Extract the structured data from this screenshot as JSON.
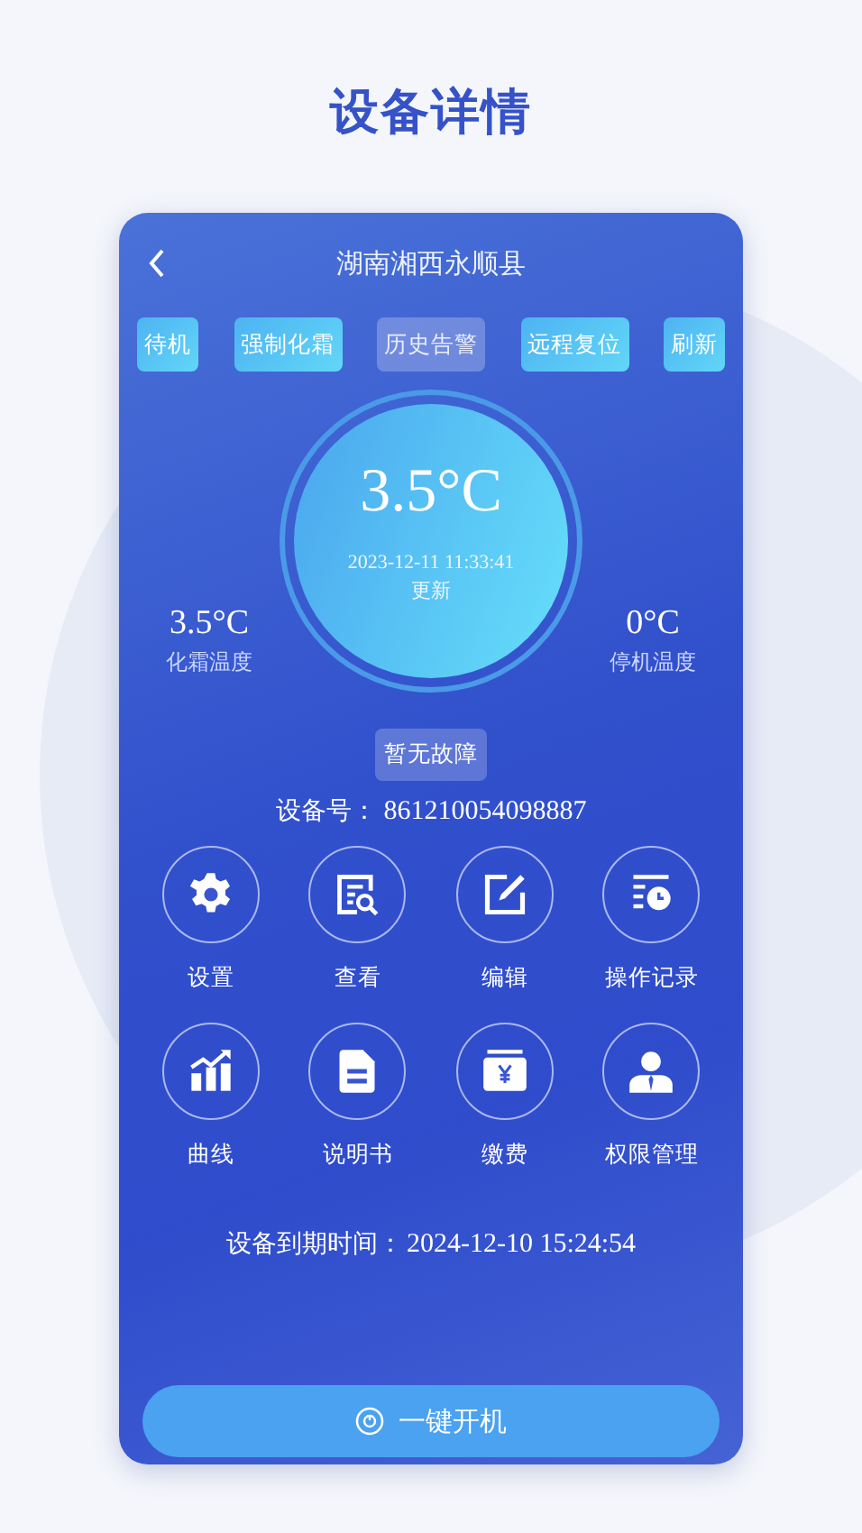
{
  "page_title": "设备详情",
  "header": {
    "title": "湖南湘西永顺县"
  },
  "actions": [
    {
      "label": "待机",
      "disabled": false
    },
    {
      "label": "强制化霜",
      "disabled": false
    },
    {
      "label": "历史告警",
      "disabled": true
    },
    {
      "label": "远程复位",
      "disabled": false
    },
    {
      "label": "刷新",
      "disabled": false
    }
  ],
  "gauge": {
    "temperature": "3.5°C",
    "timestamp": "2023-12-11 11:33:41",
    "update_label": "更新"
  },
  "left_reading": {
    "value": "3.5°C",
    "label": "化霜温度"
  },
  "right_reading": {
    "value": "0°C",
    "label": "停机温度"
  },
  "fault_status": "暂无故障",
  "device_id": {
    "label": "设备号：",
    "value": "861210054098887"
  },
  "menu": [
    {
      "label": "设置"
    },
    {
      "label": "查看"
    },
    {
      "label": "编辑"
    },
    {
      "label": "操作记录"
    },
    {
      "label": "曲线"
    },
    {
      "label": "说明书"
    },
    {
      "label": "缴费"
    },
    {
      "label": "权限管理"
    }
  ],
  "expiry": {
    "label": "设备到期时间：",
    "value": "2024-12-10 15:24:54"
  },
  "power_button": {
    "label": "一键开机"
  }
}
